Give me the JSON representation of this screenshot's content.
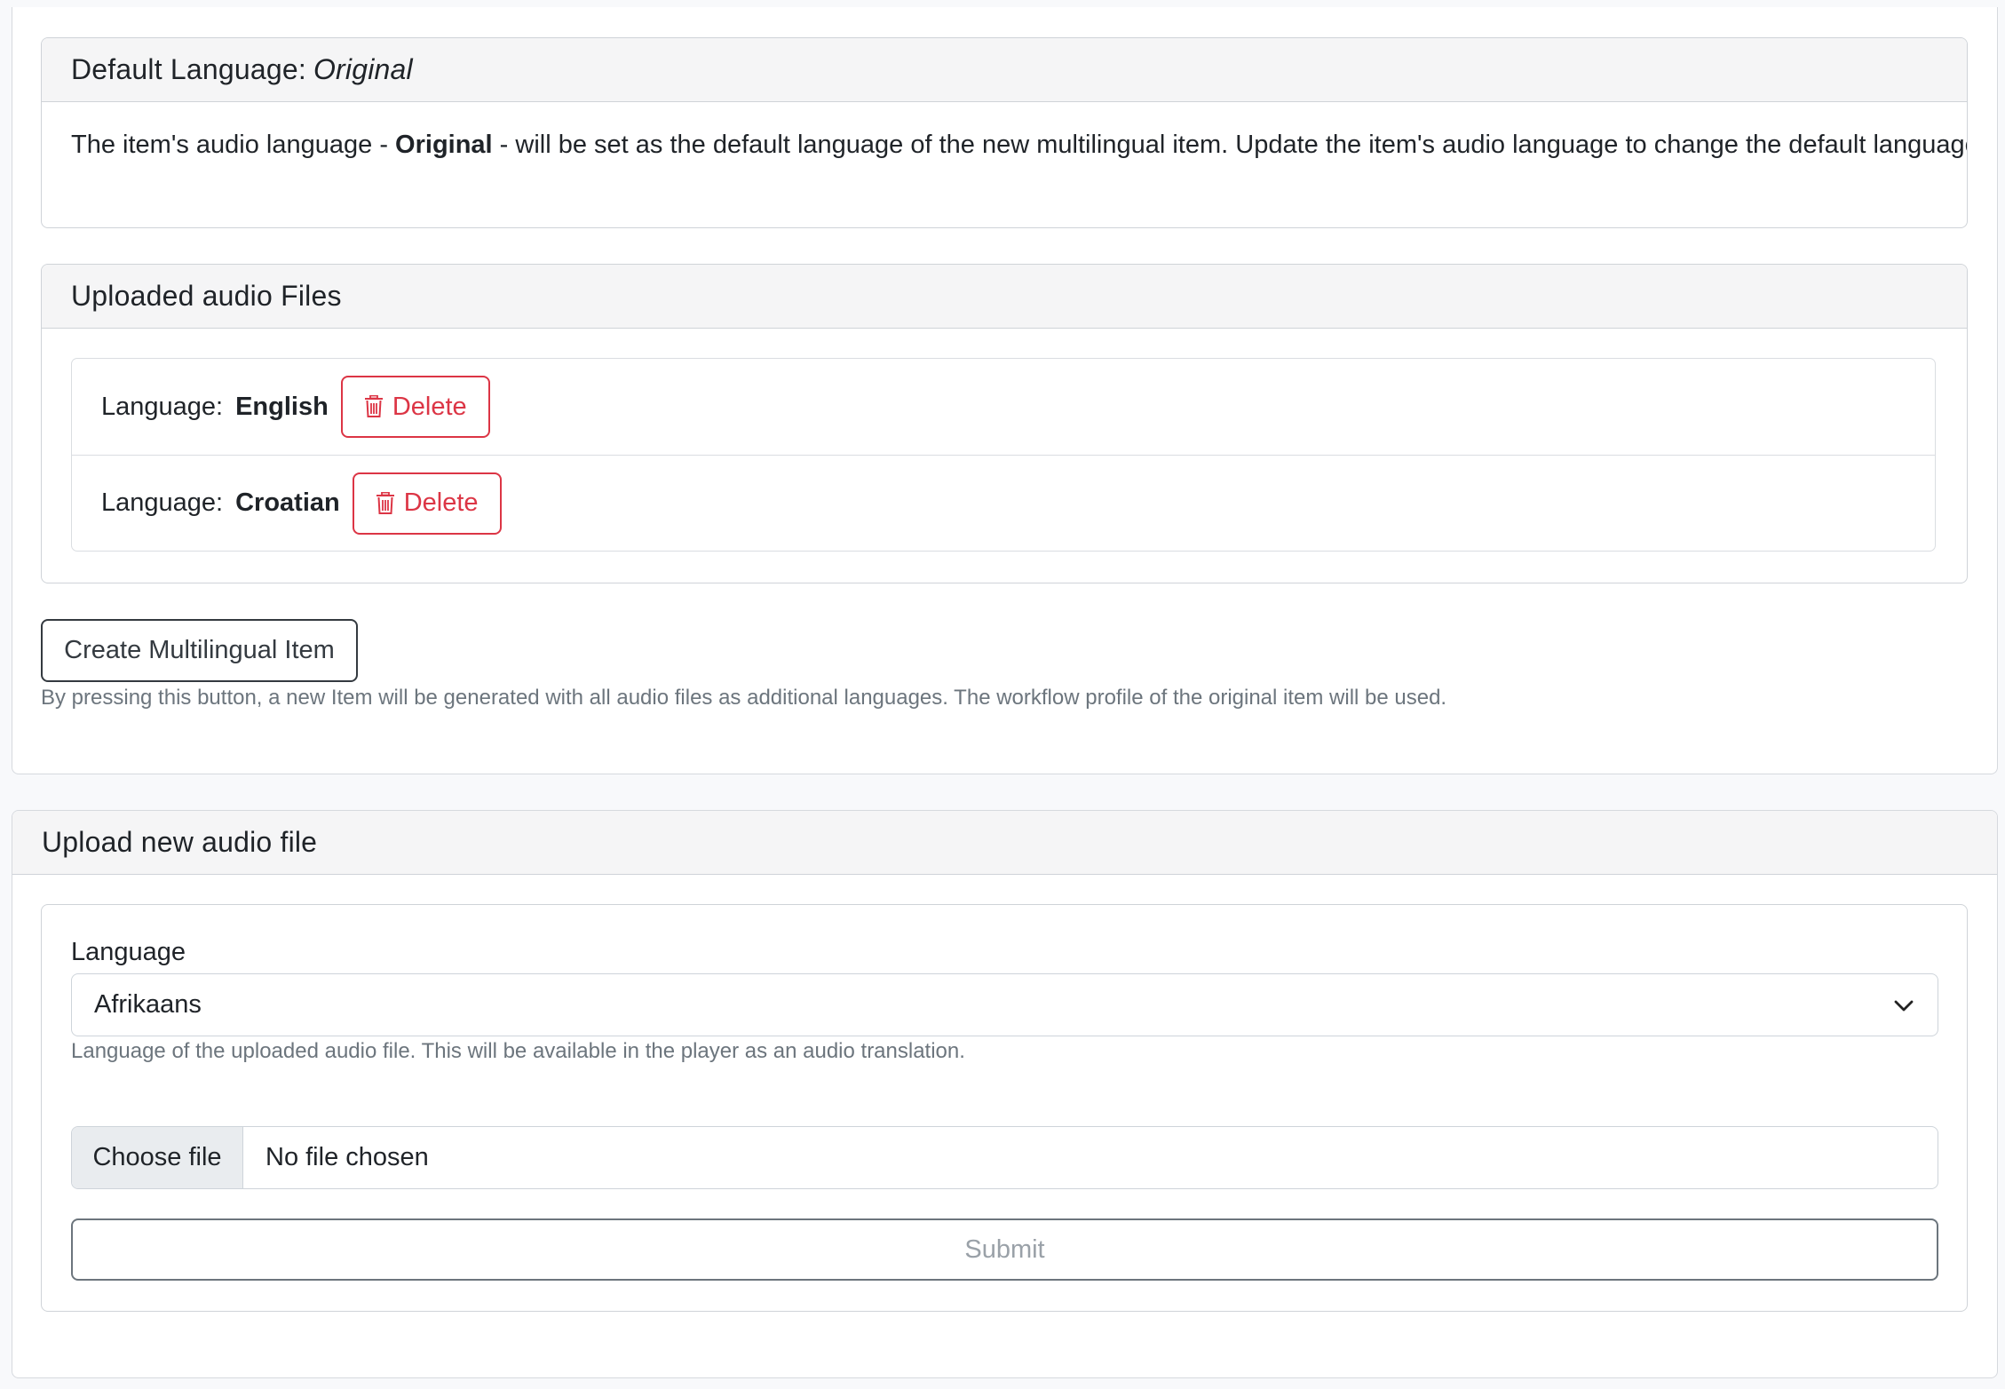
{
  "default_language_card": {
    "title_prefix": "Default Language:",
    "title_value": "Original",
    "text_before": "The item's audio language - ",
    "text_bold": "Original",
    "text_after": " - will be set as the default language of the new multilingual item. Update the item's audio language to change the default language."
  },
  "uploaded_files_card": {
    "title": "Uploaded audio Files",
    "items": [
      {
        "label": "Language:",
        "language": "English",
        "delete_label": "Delete"
      },
      {
        "label": "Language:",
        "language": "Croatian",
        "delete_label": "Delete"
      }
    ]
  },
  "create_button": {
    "label": "Create Multilingual Item",
    "help": "By pressing this button, a new Item will be generated with all audio files as additional languages. The workflow profile of the original item will be used."
  },
  "upload_section": {
    "title": "Upload new audio file",
    "language_label": "Language",
    "language_selected": "Afrikaans",
    "language_help": "Language of the uploaded audio file. This will be available in the player as an audio translation.",
    "choose_file_label": "Choose file",
    "no_file_label": "No file chosen",
    "submit_label": "Submit"
  },
  "colors": {
    "danger": "#dc3545",
    "muted": "#6c757d",
    "header_bg": "#f5f5f6"
  },
  "icons": [
    "trash-icon",
    "chevron-down-icon"
  ]
}
